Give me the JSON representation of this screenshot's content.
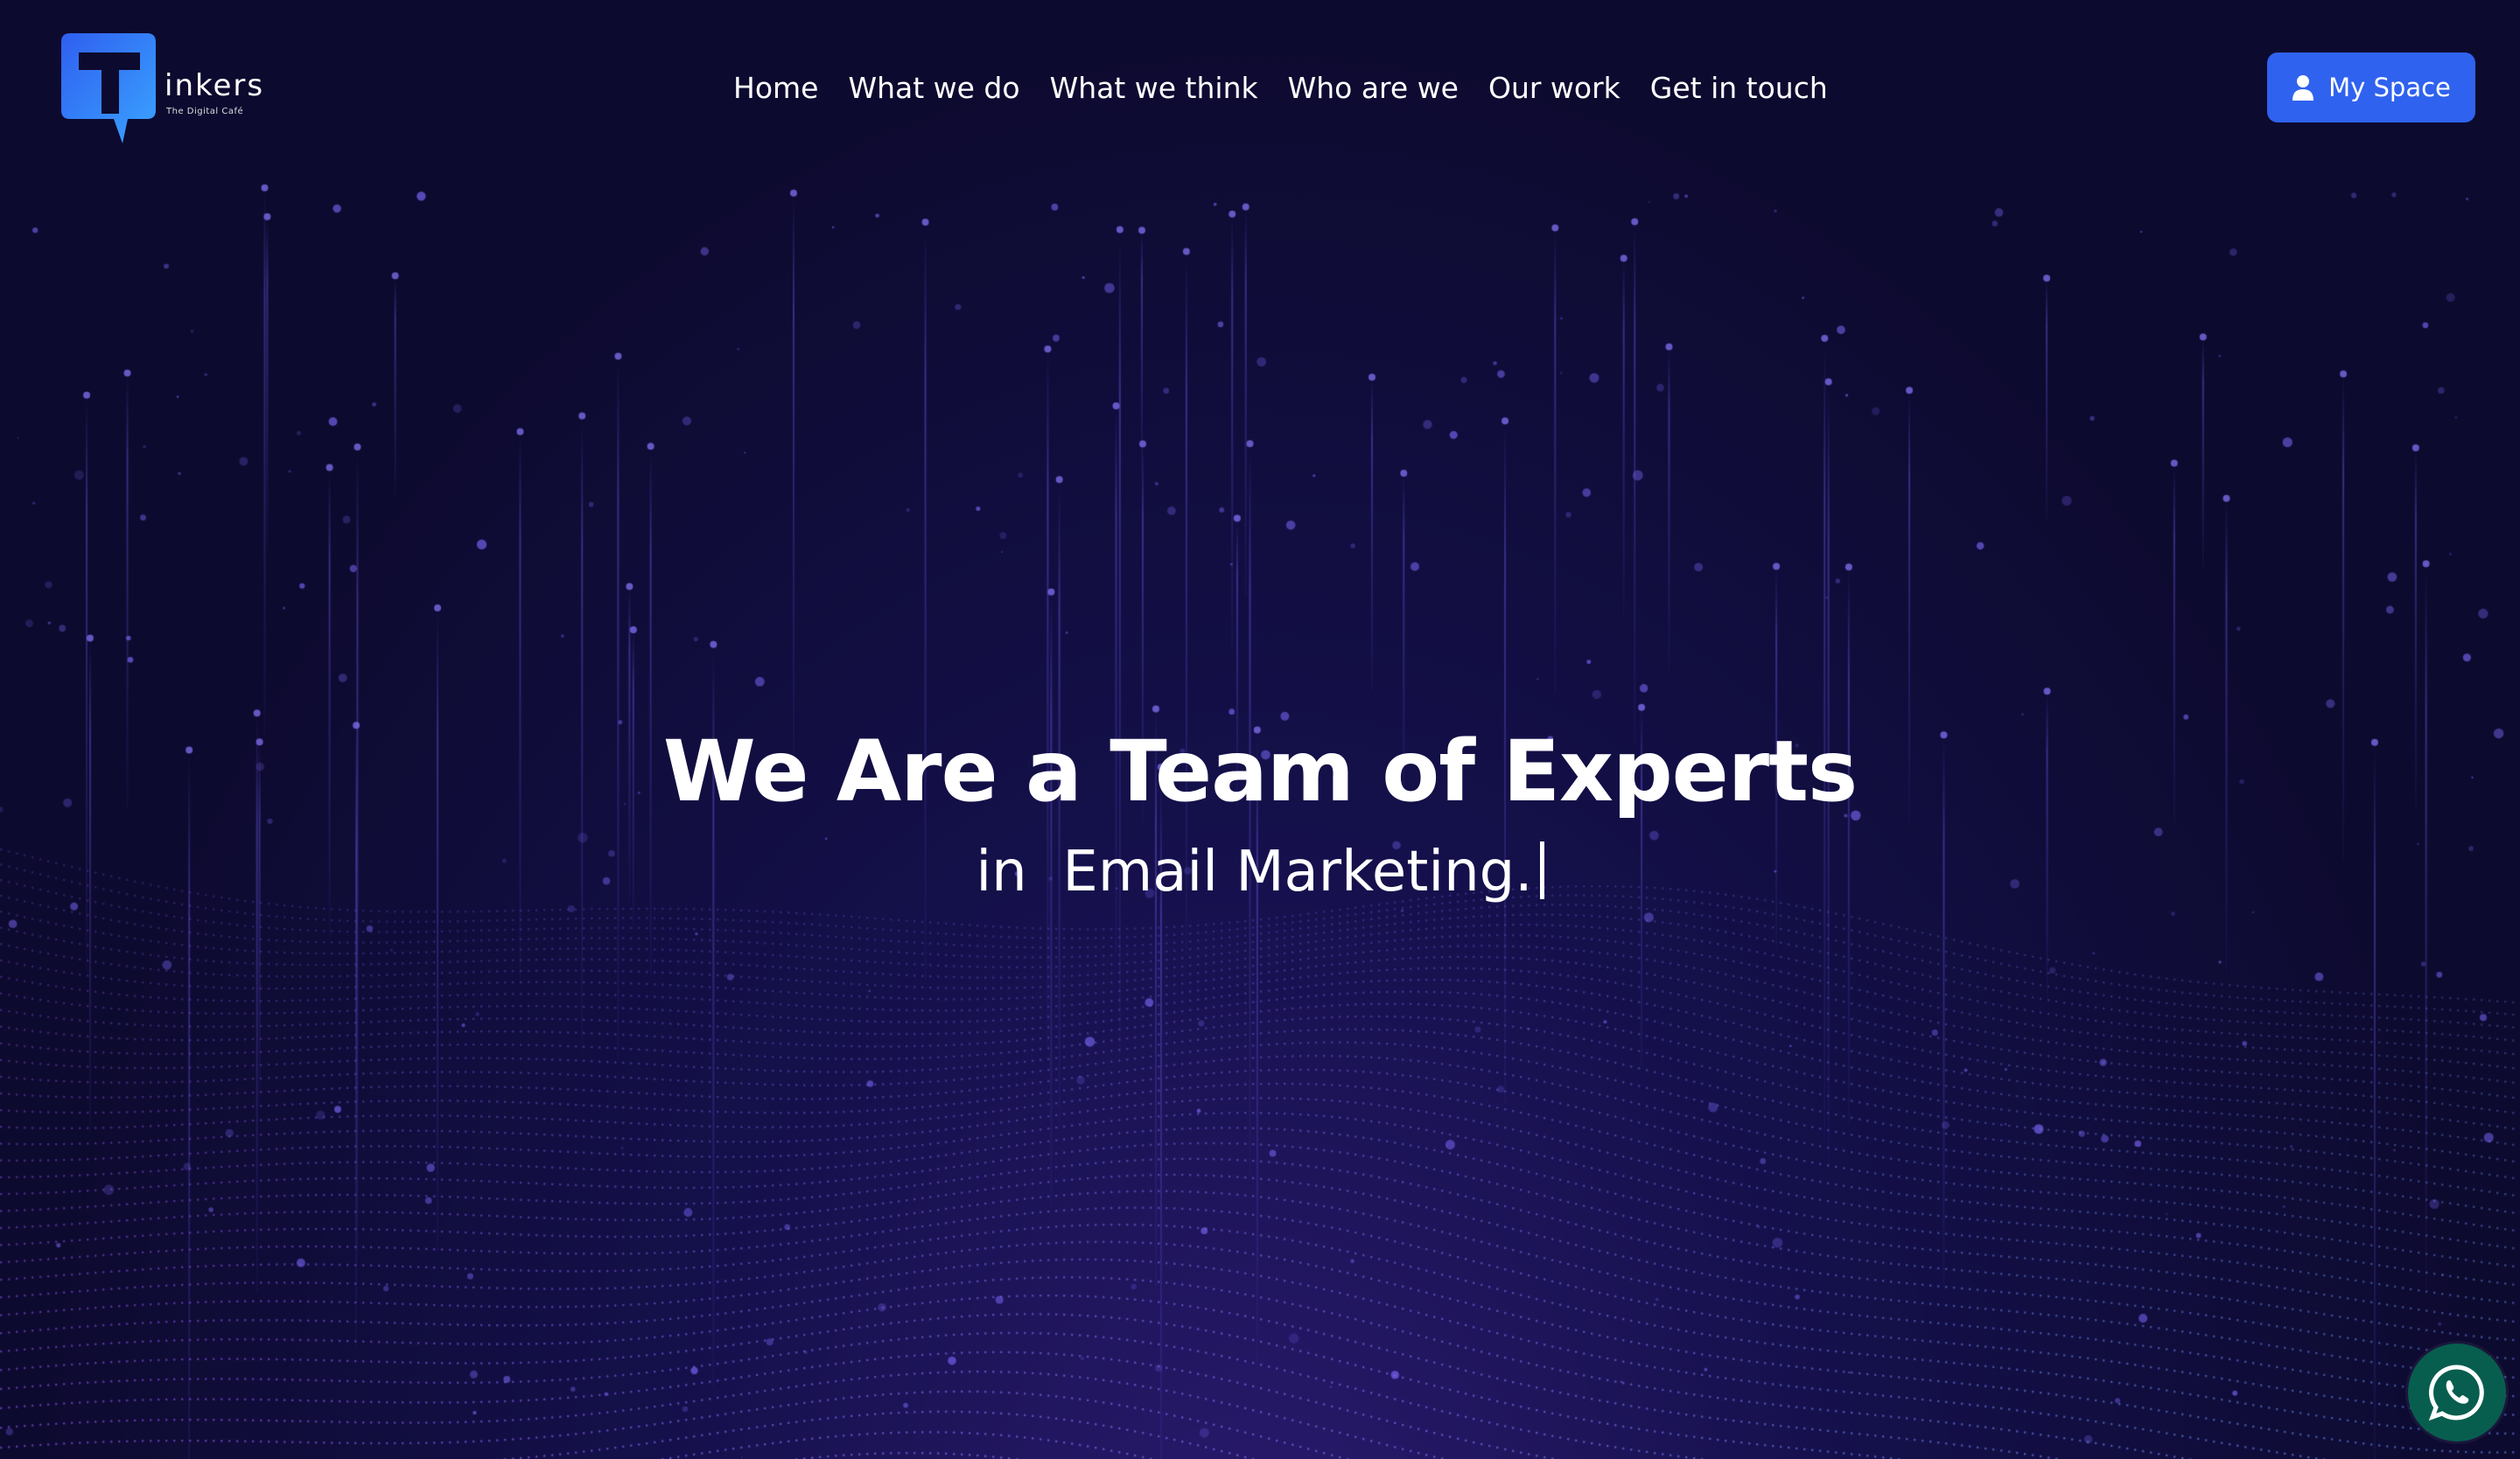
{
  "brand": {
    "name": "inkers",
    "tagline": "The Digital Café",
    "logo_icon": "tinkers-t-logo-icon",
    "logo_gradient": [
      "#2f62ef",
      "#39a7ff"
    ]
  },
  "nav": {
    "items": [
      {
        "label": "Home"
      },
      {
        "label": "What we do"
      },
      {
        "label": "What we think"
      },
      {
        "label": "Who are we"
      },
      {
        "label": "Our work"
      },
      {
        "label": "Get in touch"
      }
    ]
  },
  "account": {
    "button_label": "My Space",
    "icon": "user-icon",
    "color": "#2f62ef"
  },
  "hero": {
    "title": "We Are a Team of Experts",
    "subtitle": "in  Email Marketing."
  },
  "whatsapp": {
    "icon": "whatsapp-icon",
    "color": "#075e4e"
  },
  "colors": {
    "background": "#0d0a2f",
    "particles_primary": "#7a4fe0",
    "particles_secondary": "#6f8fff"
  }
}
